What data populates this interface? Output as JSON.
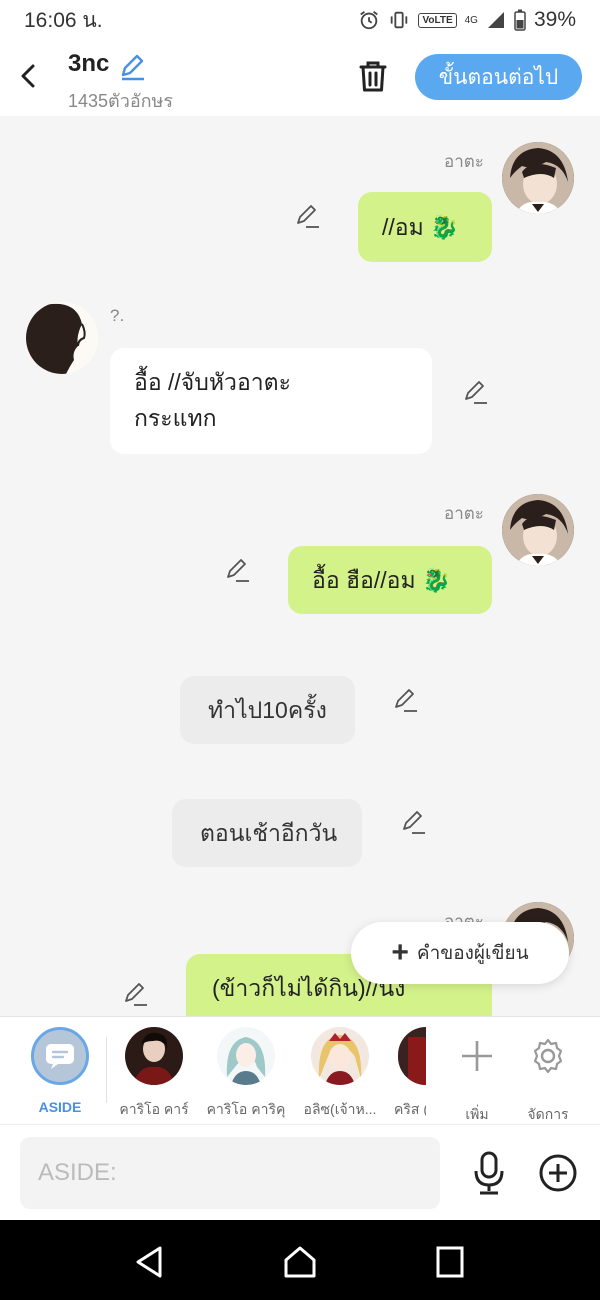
{
  "status": {
    "time": "16:06 น.",
    "battery": "39%",
    "network": "4G",
    "volte": "VoLTE"
  },
  "header": {
    "title": "3nc",
    "char_count": "1435ตัวอักษร",
    "next_label": "ขั้นตอนต่อไป"
  },
  "messages": [
    {
      "sender": "อาตะ",
      "text": "//อม 🐉",
      "side": "right"
    },
    {
      "sender": "?.",
      "text_line1": "อื้อ //จับหัวอาตะ",
      "text_line2": "กระแทก",
      "side": "left"
    },
    {
      "sender": "อาตะ",
      "text": "อื้อ ฮือ//อม 🐉",
      "side": "right"
    },
    {
      "text": "ทำไป10ครั้ง",
      "side": "center"
    },
    {
      "text": "ตอนเช้าอีกวัน",
      "side": "center"
    },
    {
      "sender": "อาตะ",
      "text": "(ข้าวก็ไม่ได้กิน)//นง",
      "side": "right"
    }
  ],
  "fab": {
    "label": "คำของผู้เขียน"
  },
  "characters": [
    {
      "label": "ASIDE"
    },
    {
      "label": "คาริโอ คาร์"
    },
    {
      "label": "คาริโอ คาริคุ"
    },
    {
      "label": "อลิซ(เจ้าห..."
    },
    {
      "label": "คริส ("
    }
  ],
  "actions": {
    "add_label": "เพิ่ม",
    "manage_label": "จัดการ"
  },
  "input": {
    "placeholder": "ASIDE:"
  },
  "colors": {
    "accent": "#5aa9f0",
    "bubble_green": "#d4f28a",
    "aside_blue": "#4a90e2"
  }
}
